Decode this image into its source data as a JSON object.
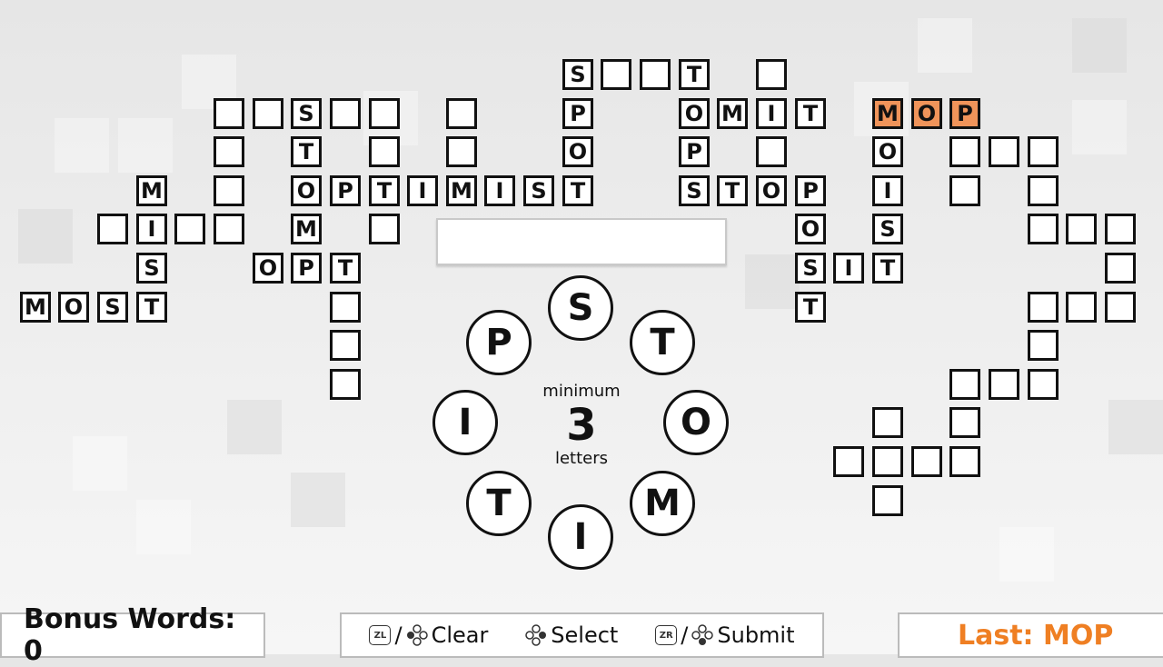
{
  "grid": [
    {
      "col": 15,
      "row": 0,
      "letter": "S"
    },
    {
      "col": 16,
      "row": 0,
      "letter": ""
    },
    {
      "col": 17,
      "row": 0,
      "letter": ""
    },
    {
      "col": 18,
      "row": 0,
      "letter": "T"
    },
    {
      "col": 20,
      "row": 0,
      "letter": ""
    },
    {
      "col": 6,
      "row": 1,
      "letter": ""
    },
    {
      "col": 7,
      "row": 1,
      "letter": ""
    },
    {
      "col": 8,
      "row": 1,
      "letter": "S"
    },
    {
      "col": 9,
      "row": 1,
      "letter": ""
    },
    {
      "col": 10,
      "row": 1,
      "letter": ""
    },
    {
      "col": 12,
      "row": 1,
      "letter": ""
    },
    {
      "col": 15,
      "row": 1,
      "letter": "P"
    },
    {
      "col": 18,
      "row": 1,
      "letter": "O"
    },
    {
      "col": 19,
      "row": 1,
      "letter": "M"
    },
    {
      "col": 20,
      "row": 1,
      "letter": "I"
    },
    {
      "col": 21,
      "row": 1,
      "letter": "T"
    },
    {
      "col": 23,
      "row": 1,
      "letter": "M",
      "hl": true
    },
    {
      "col": 24,
      "row": 1,
      "letter": "O",
      "hl": true
    },
    {
      "col": 25,
      "row": 1,
      "letter": "P",
      "hl": true
    },
    {
      "col": 6,
      "row": 2,
      "letter": ""
    },
    {
      "col": 8,
      "row": 2,
      "letter": "T"
    },
    {
      "col": 10,
      "row": 2,
      "letter": ""
    },
    {
      "col": 12,
      "row": 2,
      "letter": ""
    },
    {
      "col": 15,
      "row": 2,
      "letter": "O"
    },
    {
      "col": 18,
      "row": 2,
      "letter": "P"
    },
    {
      "col": 20,
      "row": 2,
      "letter": ""
    },
    {
      "col": 23,
      "row": 2,
      "letter": "O"
    },
    {
      "col": 25,
      "row": 2,
      "letter": ""
    },
    {
      "col": 26,
      "row": 2,
      "letter": ""
    },
    {
      "col": 27,
      "row": 2,
      "letter": ""
    },
    {
      "col": 4,
      "row": 3,
      "letter": "M"
    },
    {
      "col": 6,
      "row": 3,
      "letter": ""
    },
    {
      "col": 8,
      "row": 3,
      "letter": "O"
    },
    {
      "col": 9,
      "row": 3,
      "letter": "P"
    },
    {
      "col": 10,
      "row": 3,
      "letter": "T"
    },
    {
      "col": 11,
      "row": 3,
      "letter": "I"
    },
    {
      "col": 12,
      "row": 3,
      "letter": "M"
    },
    {
      "col": 13,
      "row": 3,
      "letter": "I"
    },
    {
      "col": 14,
      "row": 3,
      "letter": "S"
    },
    {
      "col": 15,
      "row": 3,
      "letter": "T"
    },
    {
      "col": 18,
      "row": 3,
      "letter": "S"
    },
    {
      "col": 19,
      "row": 3,
      "letter": "T"
    },
    {
      "col": 20,
      "row": 3,
      "letter": "O"
    },
    {
      "col": 21,
      "row": 3,
      "letter": "P"
    },
    {
      "col": 23,
      "row": 3,
      "letter": "I"
    },
    {
      "col": 25,
      "row": 3,
      "letter": ""
    },
    {
      "col": 27,
      "row": 3,
      "letter": ""
    },
    {
      "col": 3,
      "row": 4,
      "letter": ""
    },
    {
      "col": 4,
      "row": 4,
      "letter": "I"
    },
    {
      "col": 5,
      "row": 4,
      "letter": ""
    },
    {
      "col": 6,
      "row": 4,
      "letter": ""
    },
    {
      "col": 8,
      "row": 4,
      "letter": "M"
    },
    {
      "col": 10,
      "row": 4,
      "letter": ""
    },
    {
      "col": 21,
      "row": 4,
      "letter": "O"
    },
    {
      "col": 23,
      "row": 4,
      "letter": "S"
    },
    {
      "col": 27,
      "row": 4,
      "letter": ""
    },
    {
      "col": 28,
      "row": 4,
      "letter": ""
    },
    {
      "col": 29,
      "row": 4,
      "letter": ""
    },
    {
      "col": 4,
      "row": 5,
      "letter": "S"
    },
    {
      "col": 7,
      "row": 5,
      "letter": "O"
    },
    {
      "col": 8,
      "row": 5,
      "letter": "P"
    },
    {
      "col": 9,
      "row": 5,
      "letter": "T"
    },
    {
      "col": 21,
      "row": 5,
      "letter": "S"
    },
    {
      "col": 22,
      "row": 5,
      "letter": "I"
    },
    {
      "col": 23,
      "row": 5,
      "letter": "T"
    },
    {
      "col": 29,
      "row": 5,
      "letter": ""
    },
    {
      "col": 1,
      "row": 6,
      "letter": "M"
    },
    {
      "col": 2,
      "row": 6,
      "letter": "O"
    },
    {
      "col": 3,
      "row": 6,
      "letter": "S"
    },
    {
      "col": 4,
      "row": 6,
      "letter": "T"
    },
    {
      "col": 9,
      "row": 6,
      "letter": ""
    },
    {
      "col": 21,
      "row": 6,
      "letter": "T"
    },
    {
      "col": 27,
      "row": 6,
      "letter": ""
    },
    {
      "col": 28,
      "row": 6,
      "letter": ""
    },
    {
      "col": 29,
      "row": 6,
      "letter": ""
    },
    {
      "col": 9,
      "row": 7,
      "letter": ""
    },
    {
      "col": 27,
      "row": 7,
      "letter": ""
    },
    {
      "col": 9,
      "row": 8,
      "letter": ""
    },
    {
      "col": 25,
      "row": 8,
      "letter": ""
    },
    {
      "col": 26,
      "row": 8,
      "letter": ""
    },
    {
      "col": 27,
      "row": 8,
      "letter": ""
    },
    {
      "col": 23,
      "row": 9,
      "letter": ""
    },
    {
      "col": 25,
      "row": 9,
      "letter": ""
    },
    {
      "col": 22,
      "row": 10,
      "letter": ""
    },
    {
      "col": 23,
      "row": 10,
      "letter": ""
    },
    {
      "col": 24,
      "row": 10,
      "letter": ""
    },
    {
      "col": 25,
      "row": 10,
      "letter": ""
    },
    {
      "col": 23,
      "row": 11,
      "letter": ""
    }
  ],
  "highlight_color": "#f0945a",
  "accent_color": "#ef7f23",
  "current_word": "",
  "wheel": {
    "letters": [
      "S",
      "T",
      "O",
      "M",
      "I",
      "T",
      "I",
      "P"
    ],
    "center_top": "minimum",
    "center_number": "3",
    "center_bottom": "letters"
  },
  "footer": {
    "bonus": "Bonus Words: 0",
    "controls": {
      "zl_label": "ZL",
      "zr_label": "ZR",
      "slash": "/",
      "clear": "Clear",
      "select": "Select",
      "submit": "Submit"
    },
    "last": "Last: MOP"
  }
}
